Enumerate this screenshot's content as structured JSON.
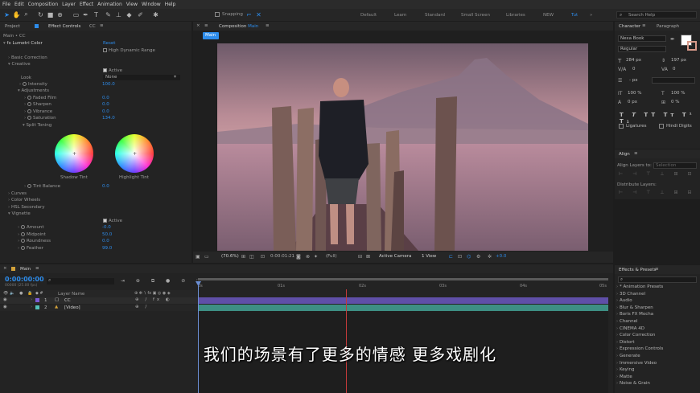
{
  "menu": [
    "File",
    "Edit",
    "Composition",
    "Layer",
    "Effect",
    "Animation",
    "View",
    "Window",
    "Help"
  ],
  "toolbar": {
    "snapping_label": "Snapping",
    "workspaces": [
      "Default",
      "Learn",
      "Standard",
      "Small Screen",
      "Libraries",
      "NEW",
      "Tut"
    ],
    "active_workspace": "Tut",
    "search_help_placeholder": "Search Help"
  },
  "left_panel": {
    "project_tab": "Project",
    "effect_controls_tab": "Effect Controls",
    "effect_controls_target": "CC",
    "path": "Main • CC",
    "effect_name": "Lumetri Color",
    "reset_label": "Reset",
    "hdr_label": "High Dynamic Range",
    "sections": {
      "basic_correction": "Basic Correction",
      "creative": "Creative",
      "curves": "Curves",
      "color_wheels": "Color Wheels",
      "hsl_secondary": "HSL Secondary",
      "vignette": "Vignette"
    },
    "active_label": "Active",
    "look_label": "Look",
    "look_value": "None",
    "intensity_label": "Intensity",
    "intensity_value": "100.0",
    "adjustments_label": "Adjustments",
    "faded_film_label": "Faded Film",
    "faded_film_value": "0.0",
    "sharpen_label": "Sharpen",
    "sharpen_value": "0.0",
    "vibrance_label": "Vibrance",
    "vibrance_value": "0.0",
    "saturation_label": "Saturation",
    "saturation_value": "134.0",
    "split_toning_label": "Split Toning",
    "shadow_tint_label": "Shadow Tint",
    "highlight_tint_label": "Highlight Tint",
    "tint_balance_label": "Tint Balance",
    "tint_balance_value": "0.0",
    "vignette_active_label": "Active",
    "amount_label": "Amount",
    "amount_value": "-0.0",
    "midpoint_label": "Midpoint",
    "midpoint_value": "50.0",
    "roundness_label": "Roundness",
    "roundness_value": "0.0",
    "feather_label": "Feather",
    "feather_value": "99.0"
  },
  "composition": {
    "tab_label": "Composition",
    "comp_name": "Main",
    "sub_tab": "Main",
    "zoom": "(70.6%)",
    "timecode": "0:00:01:21",
    "resolution": "(Full)",
    "camera": "Active Camera",
    "view": "1 View",
    "exposure": "+0.0"
  },
  "right_panel": {
    "character_tab": "Character",
    "paragraph_tab": "Paragraph",
    "font_name": "Nexa Book",
    "font_style": "Regular",
    "font_size": "284 px",
    "leading": "197 px",
    "kerning": "0",
    "tracking": "0",
    "stroke_width": "- px",
    "vscale": "100 %",
    "hscale": "100 %",
    "baseline": "0 px",
    "tsume": "0 %",
    "ligatures_label": "Ligatures",
    "hindi_digits_label": "Hindi Digits",
    "fill_color": "#ffffff",
    "stroke_color": "#d89a8a",
    "align_tab": "Align",
    "align_layers_to": "Align Layers to:",
    "align_target": "Selection",
    "distribute_layers": "Distribute Layers:",
    "effects_tab": "Effects & Presets",
    "effects_items": [
      "* Animation Presets",
      "3D Channel",
      "Audio",
      "Blur & Sharpen",
      "Boris FX Mocha",
      "Channel",
      "CINEMA 4D",
      "Color Correction",
      "Distort",
      "Expression Controls",
      "Generate",
      "Immersive Video",
      "Keying",
      "Matte",
      "Noise & Grain"
    ]
  },
  "timeline": {
    "comp_tab": "Main",
    "timecode": "0:00:00:00",
    "fps": "00000 (25.00 fps)",
    "layer_name_header": "Layer Name",
    "ruler_labels": [
      "0s",
      "01s",
      "02s",
      "03s",
      "04s",
      "05s"
    ],
    "layers": [
      {
        "index": "1",
        "name": "CC",
        "color": "#7b5bd6"
      },
      {
        "index": "2",
        "name": "[Video]",
        "color": "#53c0b8"
      }
    ]
  },
  "subtitle": "我们的场景有了更多的情感 更多戏剧化",
  "colors": {
    "accent_blue": "#2d8ceb",
    "purple_bar": "#5f4fa8",
    "teal_bar": "#3d8f84",
    "playhead": "#6c8fd4",
    "red_marker": "#c43a3a"
  }
}
